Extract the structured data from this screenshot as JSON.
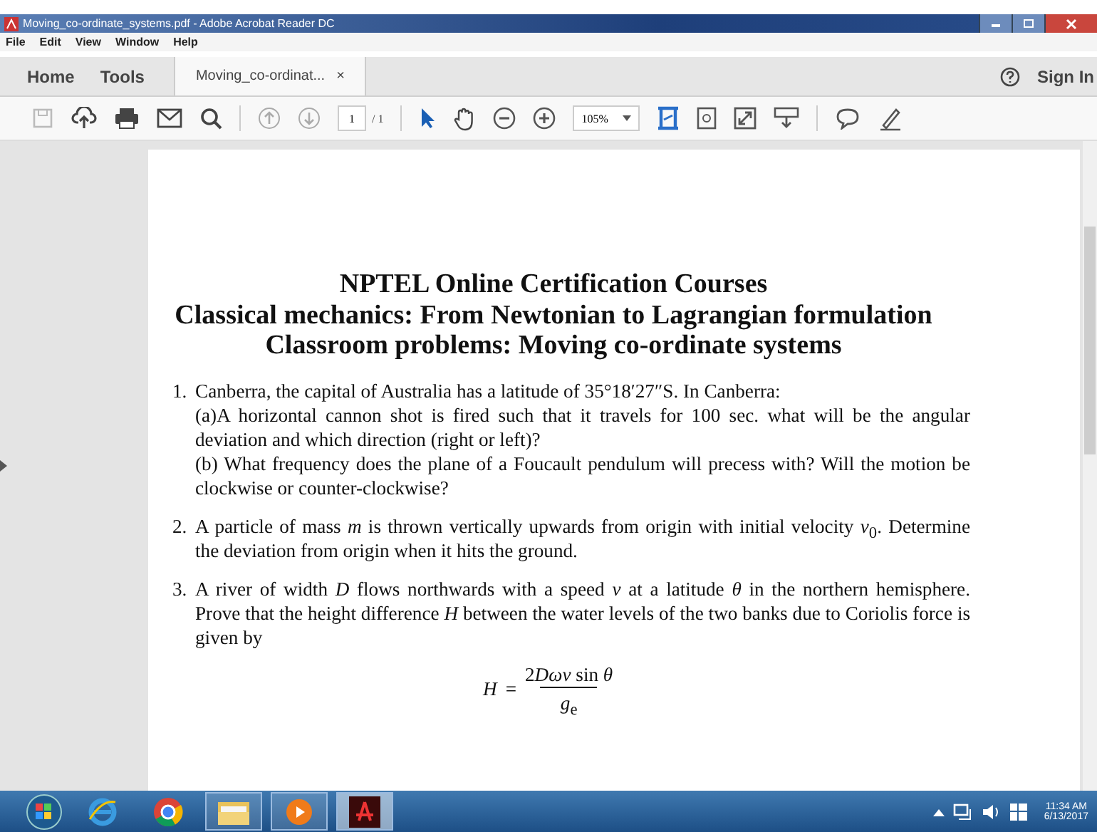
{
  "window": {
    "title": "Moving_co-ordinate_systems.pdf - Adobe Acrobat Reader DC"
  },
  "menu": [
    "File",
    "Edit",
    "View",
    "Window",
    "Help"
  ],
  "tabs": [
    {
      "label": "Home",
      "kind": "nav",
      "selected": false
    },
    {
      "label": "Tools",
      "kind": "nav",
      "selected": false
    },
    {
      "label": "Moving_co-ordinat...",
      "kind": "doc",
      "selected": true,
      "close": "×"
    }
  ],
  "sign_in": "Sign In",
  "toolbar": {
    "page": "1",
    "page_total": "/ 1",
    "zoom": "105%"
  },
  "document": {
    "headings": [
      "NPTEL Online Certification Courses",
      "Classical mechanics: From Newtonian to Lagrangian formulation",
      "Classroom problems: Moving co-ordinate systems"
    ],
    "problems": [
      {
        "number": "1.",
        "paragraphs": [
          "Canberra, the capital of Australia has a latitude of 35°18′27″S. In Canberra:",
          "(a)A horizontal cannon shot is fired such that it travels for 100 sec. what will be the angular deviation and which direction (right or left)?",
          "(b) What frequency does the plane of a Foucault pendulum will precess with? Will the motion be clockwise or counter-clockwise?"
        ]
      },
      {
        "number": "2.",
        "paragraphs": [
          "A particle of mass *m* is thrown vertically upwards from origin with initial velocity *v*$_{0}$. Determine the deviation from origin when it hits the ground."
        ]
      },
      {
        "number": "3.",
        "paragraphs": [
          "A river of width *D* flows northwards with a speed *v* at a latitude *θ* in the northern hemisphere. Prove that the height difference *H* between the water levels of the two banks due to Coriolis force is given by"
        ]
      }
    ],
    "formula": {
      "lhs": "H",
      "equals": "=",
      "coefficient": "2",
      "numerator": "*Dωv* sin *θ*",
      "denominator": "*g*$_{e}$"
    }
  },
  "taskbar": {
    "apps": [
      {
        "kind": "ie",
        "running": false,
        "selected": false
      },
      {
        "kind": "chrome",
        "running": false,
        "selected": false
      },
      {
        "kind": "folder",
        "running": true,
        "selected": false
      },
      {
        "kind": "media",
        "running": true,
        "selected": false
      },
      {
        "kind": "acrobat",
        "running": true,
        "selected": true
      }
    ],
    "clock": {
      "time": "11:34 AM",
      "date": "6/13/2017"
    }
  }
}
